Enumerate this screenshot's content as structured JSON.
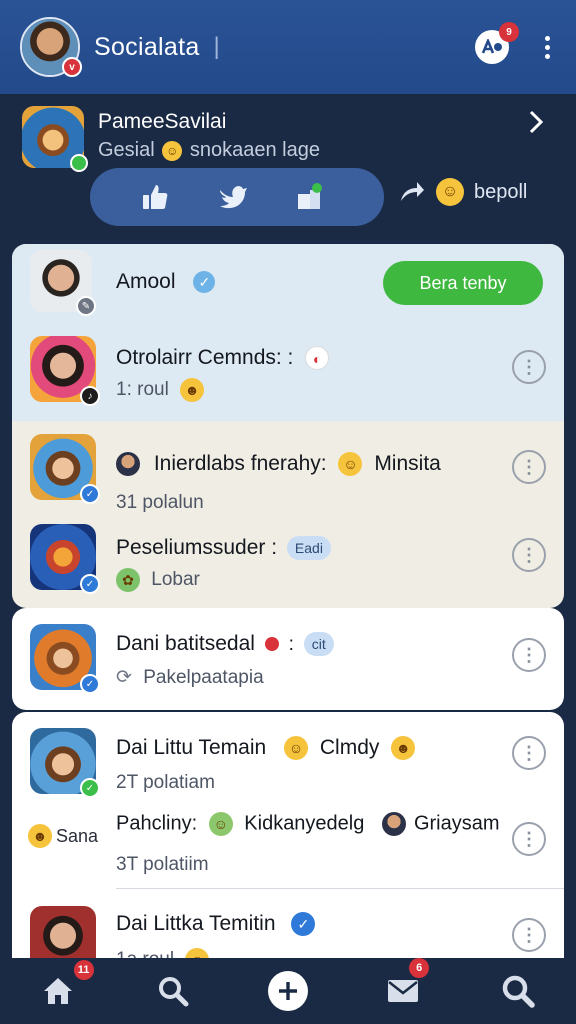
{
  "colors": {
    "topbar": "#234a8a",
    "background": "#1b2a44",
    "accent_green": "#3fb83f",
    "badge_red": "#d8323a",
    "card_blue": "#dde9f3",
    "card_cream": "#f0ede4"
  },
  "topbar": {
    "title": "Socialata",
    "caret": "|",
    "avatar_badge": "v",
    "notif_badge": "9",
    "notif_icon": "A●"
  },
  "featured": {
    "name": "PameeSavilai",
    "subtitle_a": "Gesial",
    "subtitle_b": "snokaaen  lage",
    "extra_label": "bepoll"
  },
  "card_a": {
    "header": {
      "name": "Amool",
      "follow_label": "Bera tenby"
    },
    "rows": [
      {
        "title": "Otrolairr Cemnds: :",
        "sub": "1: roul"
      },
      {
        "title_a": "Inierdlabs fnerahy:",
        "title_b": "Minsita",
        "sub": "31 polalun"
      },
      {
        "title": "Peseliumssuder :",
        "chip": "Eadi",
        "sub": "Lobar"
      }
    ]
  },
  "card_b": {
    "row": {
      "title": "Dani batitsedal",
      "chip": "cit",
      "sub": "Pakelpaatapia"
    }
  },
  "card_c": {
    "rows": [
      {
        "title_a": "Dai Littu Temain",
        "title_b": "Clmdy",
        "sub": "2T polatiam"
      },
      {
        "title_a": "Pahcliny:",
        "title_b": "Kidkanyedelg",
        "title_c": "Griaysam",
        "sub": "3T polatiim"
      },
      {
        "title": "Dai Littka Temitin",
        "sub": "1a roul"
      }
    ],
    "side_label": "Sana"
  },
  "bottom_nav": {
    "home_badge": "11",
    "mail_badge": "6"
  }
}
